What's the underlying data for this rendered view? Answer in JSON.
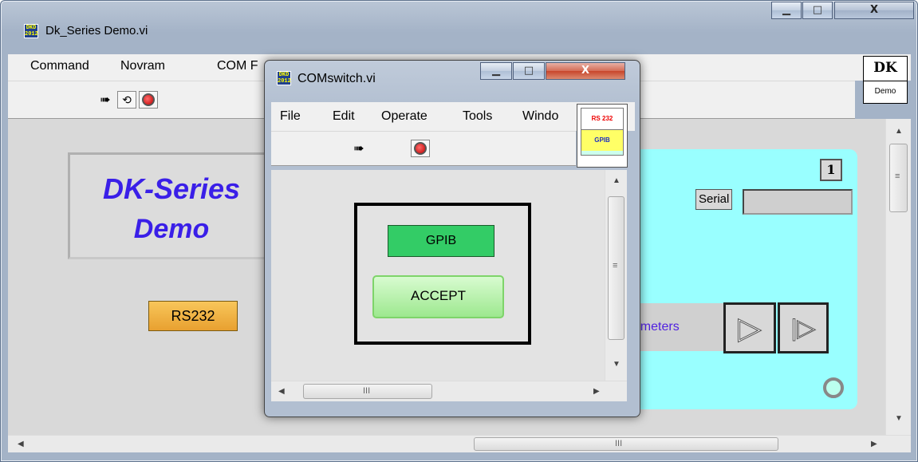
{
  "main_window": {
    "icon_top": "DKD",
    "icon_bottom": "2012",
    "title": "Dk_Series Demo.vi",
    "menu": [
      "Command",
      "Novram",
      "COM F"
    ],
    "logo_top": "DK",
    "logo_bottom": "Demo",
    "banner_line1": "DK-Series",
    "banner_line2": "Demo",
    "rs232_button": "RS232",
    "counter": "1",
    "serial_label": "Serial",
    "serial_value": "",
    "instruments_button": "nometers",
    "scroll_grip": "III",
    "scroll_grip_v": "≡"
  },
  "dialog": {
    "icon_top": "DKD",
    "icon_bottom": "2012",
    "title": "COMswitch.vi",
    "menu": [
      "File",
      "Edit",
      "Operate",
      "Tools",
      "Windo"
    ],
    "icon_rs": "RS 232",
    "icon_gpib": "GPIB",
    "gpib_button": "GPIB",
    "accept_button": "ACCEPT",
    "scroll_grip": "III",
    "scroll_grip_v": "≡"
  },
  "icons": {
    "run": "run-arrow-icon",
    "run_continuous": "run-continuously-icon",
    "abort": "abort-stop-icon",
    "minimize": "minimize-icon",
    "maximize": "maximize-icon",
    "close": "close-icon",
    "play": "play-icon",
    "step": "step-forward-icon",
    "busy": "busy-ring-icon"
  },
  "colors": {
    "banner_text": "#3a1fe8",
    "cyan_panel": "#99ffff",
    "rs232_fill": "#f2b742",
    "gpib_fill": "#33cc66",
    "accept_fill": "#a8f0a0"
  },
  "caption_buttons": {
    "minimize": "▁",
    "maximize": "□",
    "close": "X"
  }
}
